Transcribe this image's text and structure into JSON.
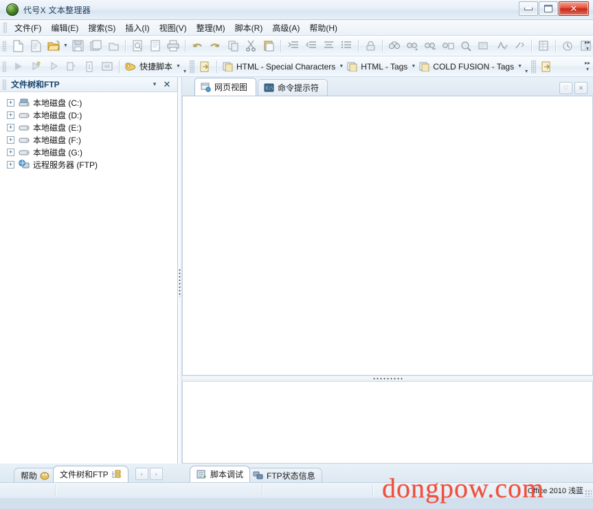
{
  "window": {
    "title": "代号X 文本整理器",
    "app_icon": "green-ball-icon",
    "minimize_label": "",
    "maximize_label": "",
    "close_label": "✕"
  },
  "menubar": {
    "items": [
      {
        "label": "文件(F)",
        "name": "menu-file"
      },
      {
        "label": "编辑(E)",
        "name": "menu-edit"
      },
      {
        "label": "搜索(S)",
        "name": "menu-search"
      },
      {
        "label": "插入(I)",
        "name": "menu-insert"
      },
      {
        "label": "视图(V)",
        "name": "menu-view"
      },
      {
        "label": "整理(M)",
        "name": "menu-organize"
      },
      {
        "label": "脚本(R)",
        "name": "menu-script"
      },
      {
        "label": "高级(A)",
        "name": "menu-advanced"
      },
      {
        "label": "帮助(H)",
        "name": "menu-help"
      }
    ]
  },
  "toolbar1": {
    "overflow_label": "▾",
    "icons": [
      "new-file-icon",
      "new-page-icon",
      "open-folder-icon",
      "save-icon",
      "save-all-icon",
      "close-file-icon",
      "print-preview-icon",
      "page-setup-icon",
      "print-icon",
      "undo-icon",
      "redo-icon",
      "copy-icon",
      "cut-icon",
      "paste-icon",
      "indent-increase-icon",
      "indent-decrease-icon",
      "align-icon",
      "list-icon",
      "lock-icon",
      "find-icon",
      "find-next-icon",
      "find-prev-icon",
      "replace-icon",
      "search-files-icon",
      "goto-line-icon",
      "spell-check-icon",
      "clean-icon",
      "table-icon",
      "history-icon",
      "properties-icon"
    ]
  },
  "toolbar2": {
    "overflow_label": "▾",
    "icons": [
      "run-icon",
      "debug-icon",
      "step-icon",
      "step-into-icon",
      "variables-icon",
      "console-icon"
    ],
    "buttons": [
      {
        "label": "快捷脚本",
        "name": "quick-script-button",
        "icon": "script-icon",
        "dropdown": true
      },
      {
        "label": "HTML - Special Characters",
        "name": "html-special-characters-button",
        "icon": "tag-icon",
        "dropdown": true
      },
      {
        "label": "HTML - Tags",
        "name": "html-tags-button",
        "icon": "tag-icon",
        "dropdown": true
      },
      {
        "label": "COLD FUSION - Tags",
        "name": "cold-fusion-tags-button",
        "icon": "tag-icon",
        "dropdown": true
      }
    ]
  },
  "left_panel": {
    "title": "文件树和FTP",
    "menu_glyph": "▾",
    "close_glyph": "✕",
    "tree": [
      {
        "label": "本地磁盘 (C:)",
        "icon": "system-drive-icon",
        "expander": "+"
      },
      {
        "label": "本地磁盘 (D:)",
        "icon": "drive-icon",
        "expander": "+"
      },
      {
        "label": "本地磁盘 (E:)",
        "icon": "drive-icon",
        "expander": "+"
      },
      {
        "label": "本地磁盘 (F:)",
        "icon": "drive-icon",
        "expander": "+"
      },
      {
        "label": "本地磁盘 (G:)",
        "icon": "drive-icon",
        "expander": "+"
      },
      {
        "label": "远程服务器 (FTP)",
        "icon": "remote-server-icon",
        "expander": "+"
      }
    ]
  },
  "editor_tabs": {
    "tabs": [
      {
        "label": "网页视图",
        "name": "tab-web-view",
        "icon": "web-view-icon",
        "active": true
      },
      {
        "label": "命令提示符",
        "name": "tab-command-prompt",
        "icon": "console-icon",
        "active": false
      }
    ],
    "corner_buttons": [
      {
        "name": "tab-favorite-button",
        "glyph": "♡"
      },
      {
        "name": "tab-close-all-button",
        "glyph": "✕"
      }
    ]
  },
  "bottom_tabs": {
    "left": [
      {
        "label": "帮助",
        "name": "btab-help",
        "icon": "help-icon",
        "active": false
      },
      {
        "label": "文件树和FTP",
        "name": "btab-file-tree-ftp",
        "icon": "file-tree-icon",
        "active": true
      }
    ],
    "nav": [
      {
        "name": "nav-prev-button",
        "glyph": "‹"
      },
      {
        "name": "nav-next-button",
        "glyph": "›"
      }
    ],
    "right": [
      {
        "label": "脚本调试",
        "name": "btab-script-debug",
        "icon": "script-debug-icon",
        "active": true
      },
      {
        "label": "FTP状态信息",
        "name": "btab-ftp-status",
        "icon": "ftp-status-icon",
        "active": false
      }
    ]
  },
  "statusbar": {
    "left_text": "",
    "right_text": "Office 2010 浅蓝"
  },
  "watermark": {
    "text": "dongpow.com",
    "color": "#f0503c"
  }
}
